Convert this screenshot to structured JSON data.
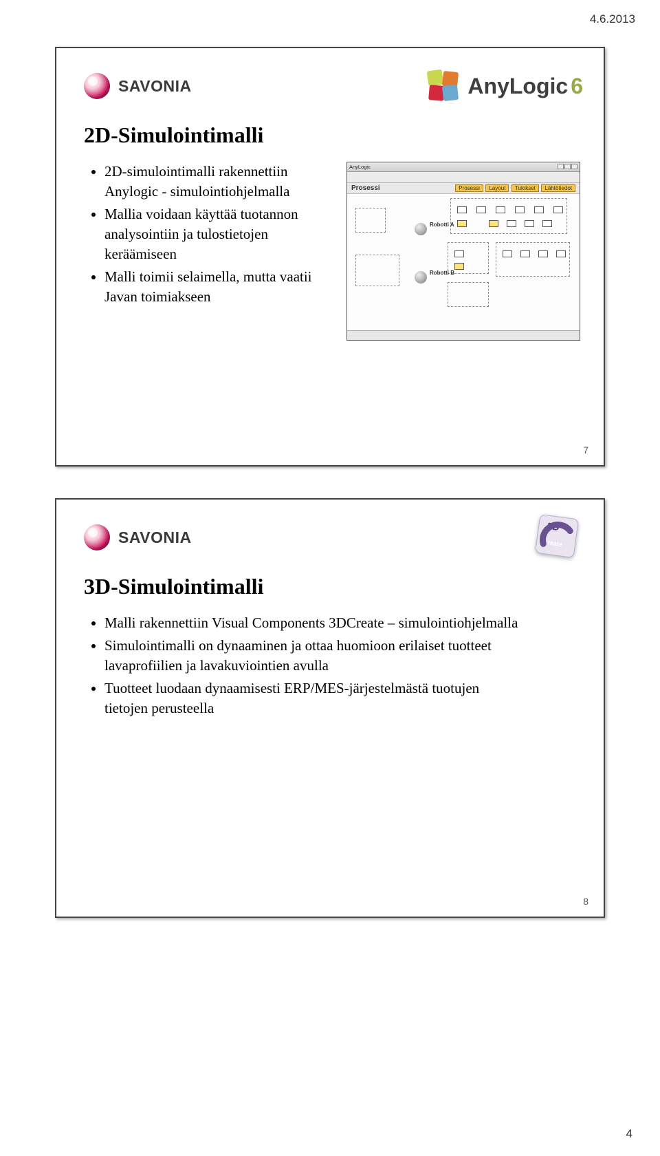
{
  "meta": {
    "date": "4.6.2013",
    "page_number": "4"
  },
  "brands": {
    "savonia": "SAVONIA",
    "anylogic": "AnyLogic",
    "anylogic_version": "6"
  },
  "slide1": {
    "number": "7",
    "title": "2D-Simulointimalli",
    "bullets": [
      "2D-simulointimalli rakennettiin Anylogic - simulointiohjelmalla",
      "Mallia voidaan käyttää tuotannon analysointiin ja tulostietojen keräämiseen",
      "Malli toimii selaimella, mutta vaatii Javan toimiakseen"
    ],
    "process_shot": {
      "title": "Prosessi",
      "tabs": [
        "Prosessi",
        "Layout",
        "Tulokset",
        "Lähtötiedot"
      ],
      "labels": {
        "robotA": "Robotti A",
        "robotB": "Robotti B"
      }
    }
  },
  "slide2": {
    "number": "8",
    "title": "3D-Simulointimalli",
    "bullets": [
      "Malli rakennettiin Visual Components 3DCreate – simulointiohjelmalla",
      "Simulointimalli on dynaaminen ja ottaa huomioon erilaiset tuotteet lavaprofiilien ja lavakuviointien avulla",
      "Tuotteet luodaan dynaamisesti ERP/MES-järjestelmästä tuotujen tietojen perusteella"
    ]
  }
}
